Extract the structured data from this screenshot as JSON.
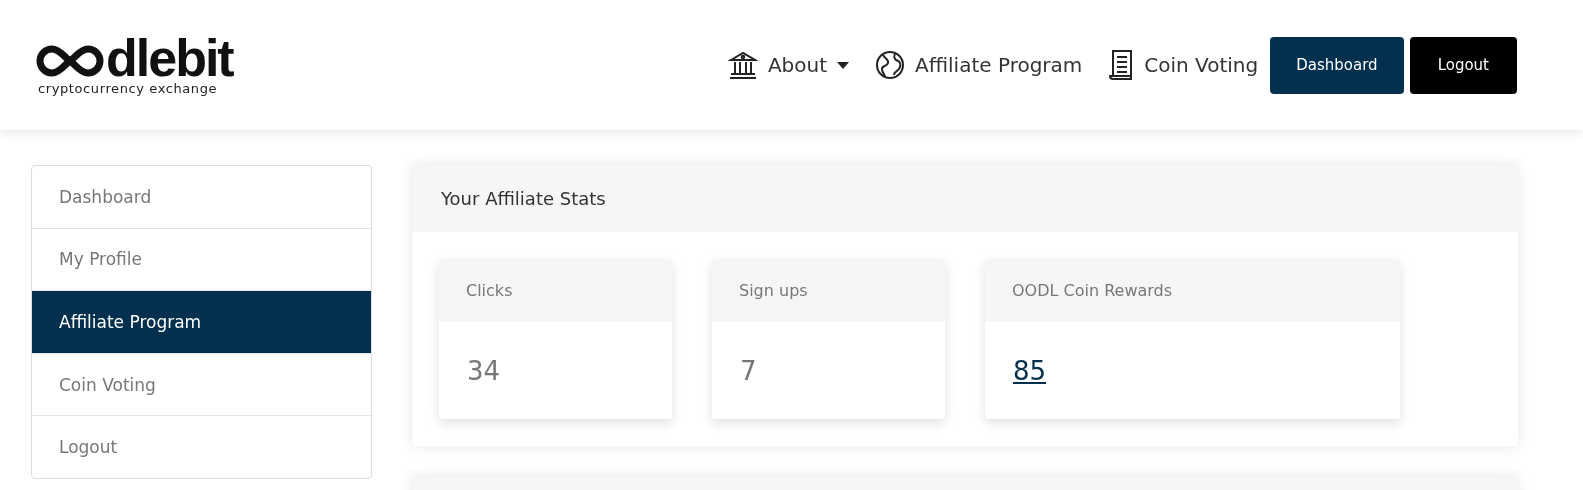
{
  "logo": {
    "wordmark": "dlebit",
    "tagline": "cryptocurrency exchange"
  },
  "nav": [
    {
      "kind": "dropdown",
      "label": "About"
    },
    {
      "kind": "link",
      "label": "Affiliate Program"
    },
    {
      "kind": "link",
      "label": "Coin Voting"
    },
    {
      "kind": "primary",
      "label": "Dashboard"
    },
    {
      "kind": "dark",
      "label": "Logout"
    }
  ],
  "sidebar": {
    "items": [
      {
        "label": "Dashboard",
        "selected": false
      },
      {
        "label": "My Profile",
        "selected": false
      },
      {
        "label": "Affiliate Program",
        "selected": true
      },
      {
        "label": "Coin Voting",
        "selected": false
      },
      {
        "label": "Logout",
        "selected": false
      }
    ]
  },
  "stats_panel": {
    "title": "Your Affiliate Stats",
    "cards": [
      {
        "label": "Clicks",
        "value": "34",
        "kind": "plain"
      },
      {
        "label": "Sign ups",
        "value": "7",
        "kind": "plain"
      },
      {
        "label": "OODL Coin Rewards",
        "value": "85",
        "kind": "link"
      }
    ]
  }
}
